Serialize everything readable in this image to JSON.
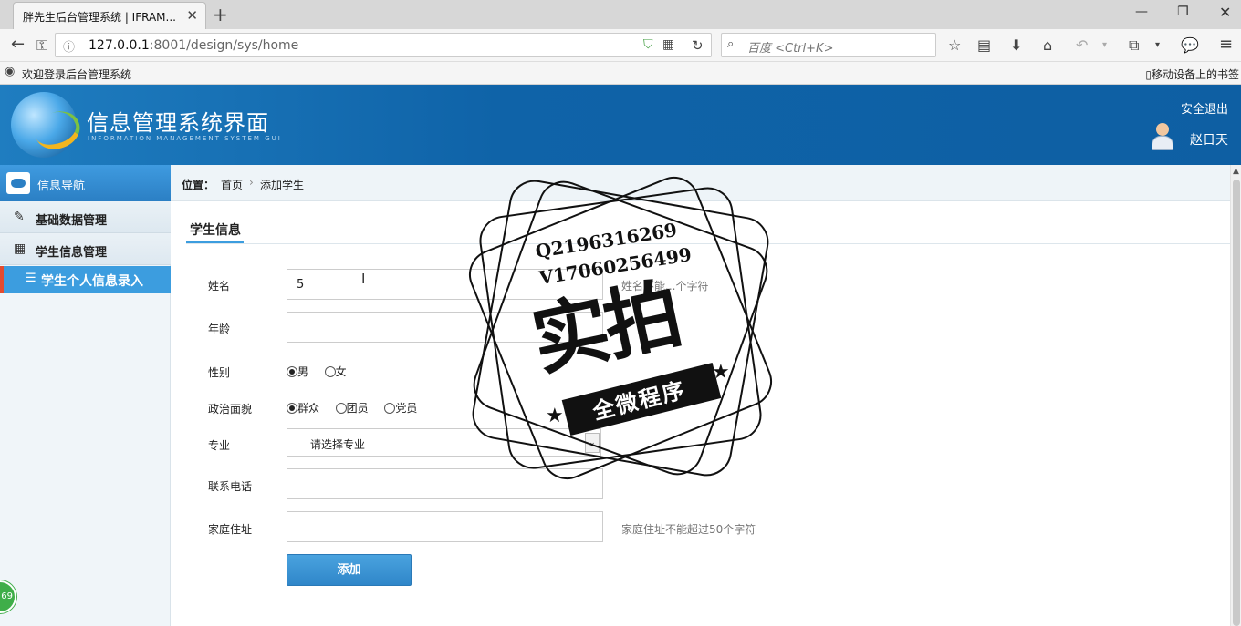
{
  "browser": {
    "tab_title": "胖先生后台管理系统 | IFRAM...",
    "url_host": "127.0.0.1",
    "url_rest": ":8001/design/sys/home",
    "search_placeholder": "百度 <Ctrl+K>",
    "bookmark_left": "欢迎登录后台管理系统",
    "bookmark_right": "移动设备上的书签"
  },
  "header": {
    "title": "信息管理系统界面",
    "subtitle": "INFORMATION MANAGEMENT SYSTEM GUI",
    "logout": "安全退出",
    "username": "赵日天"
  },
  "sidebar": {
    "head": "信息导航",
    "items": [
      {
        "label": "基础数据管理",
        "icon": "edit-icon"
      },
      {
        "label": "学生信息管理",
        "icon": "calendar-icon"
      }
    ],
    "active_sub": "学生个人信息录入"
  },
  "breadcrumb": {
    "label": "位置：",
    "home": "首页",
    "sep": "›",
    "current": "添加学生"
  },
  "form": {
    "section": "学生信息",
    "name_label": "姓名",
    "name_value": "5",
    "age_label": "年龄",
    "gender_label": "性别",
    "gender_male": "男",
    "gender_female": "女",
    "politics_label": "政治面貌",
    "politics_opts": [
      "群众",
      "团员",
      "党员"
    ],
    "major_label": "专业",
    "major_value": "请选择专业",
    "phone_label": "联系电话",
    "address_label": "家庭住址",
    "name_hint": "姓名不能...个字符",
    "address_hint": "家庭住址不能超过50个字符",
    "submit": "添加"
  },
  "stamp": {
    "q": "Q2196316269",
    "v": "V17060256499",
    "big": "实拍",
    "ribbon": "全微程序"
  },
  "badge": "69"
}
